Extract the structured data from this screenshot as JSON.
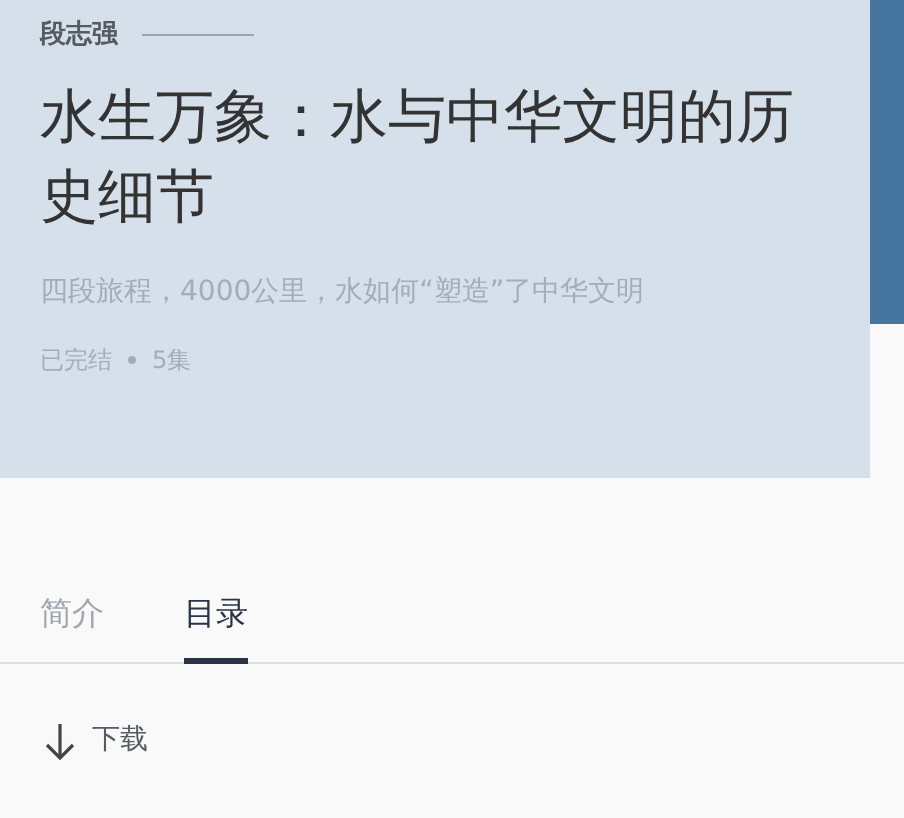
{
  "header": {
    "author": "段志强",
    "title": "水生万象：水与中华文明的历史细节",
    "subtitle": "四段旅程，4000公里，水如何“塑造”了中华文明",
    "status": "已完结",
    "episodes": "5集"
  },
  "tabs": [
    {
      "label": "简介",
      "selected": false
    },
    {
      "label": "目录",
      "selected": true
    }
  ],
  "download": {
    "label": "下载"
  }
}
